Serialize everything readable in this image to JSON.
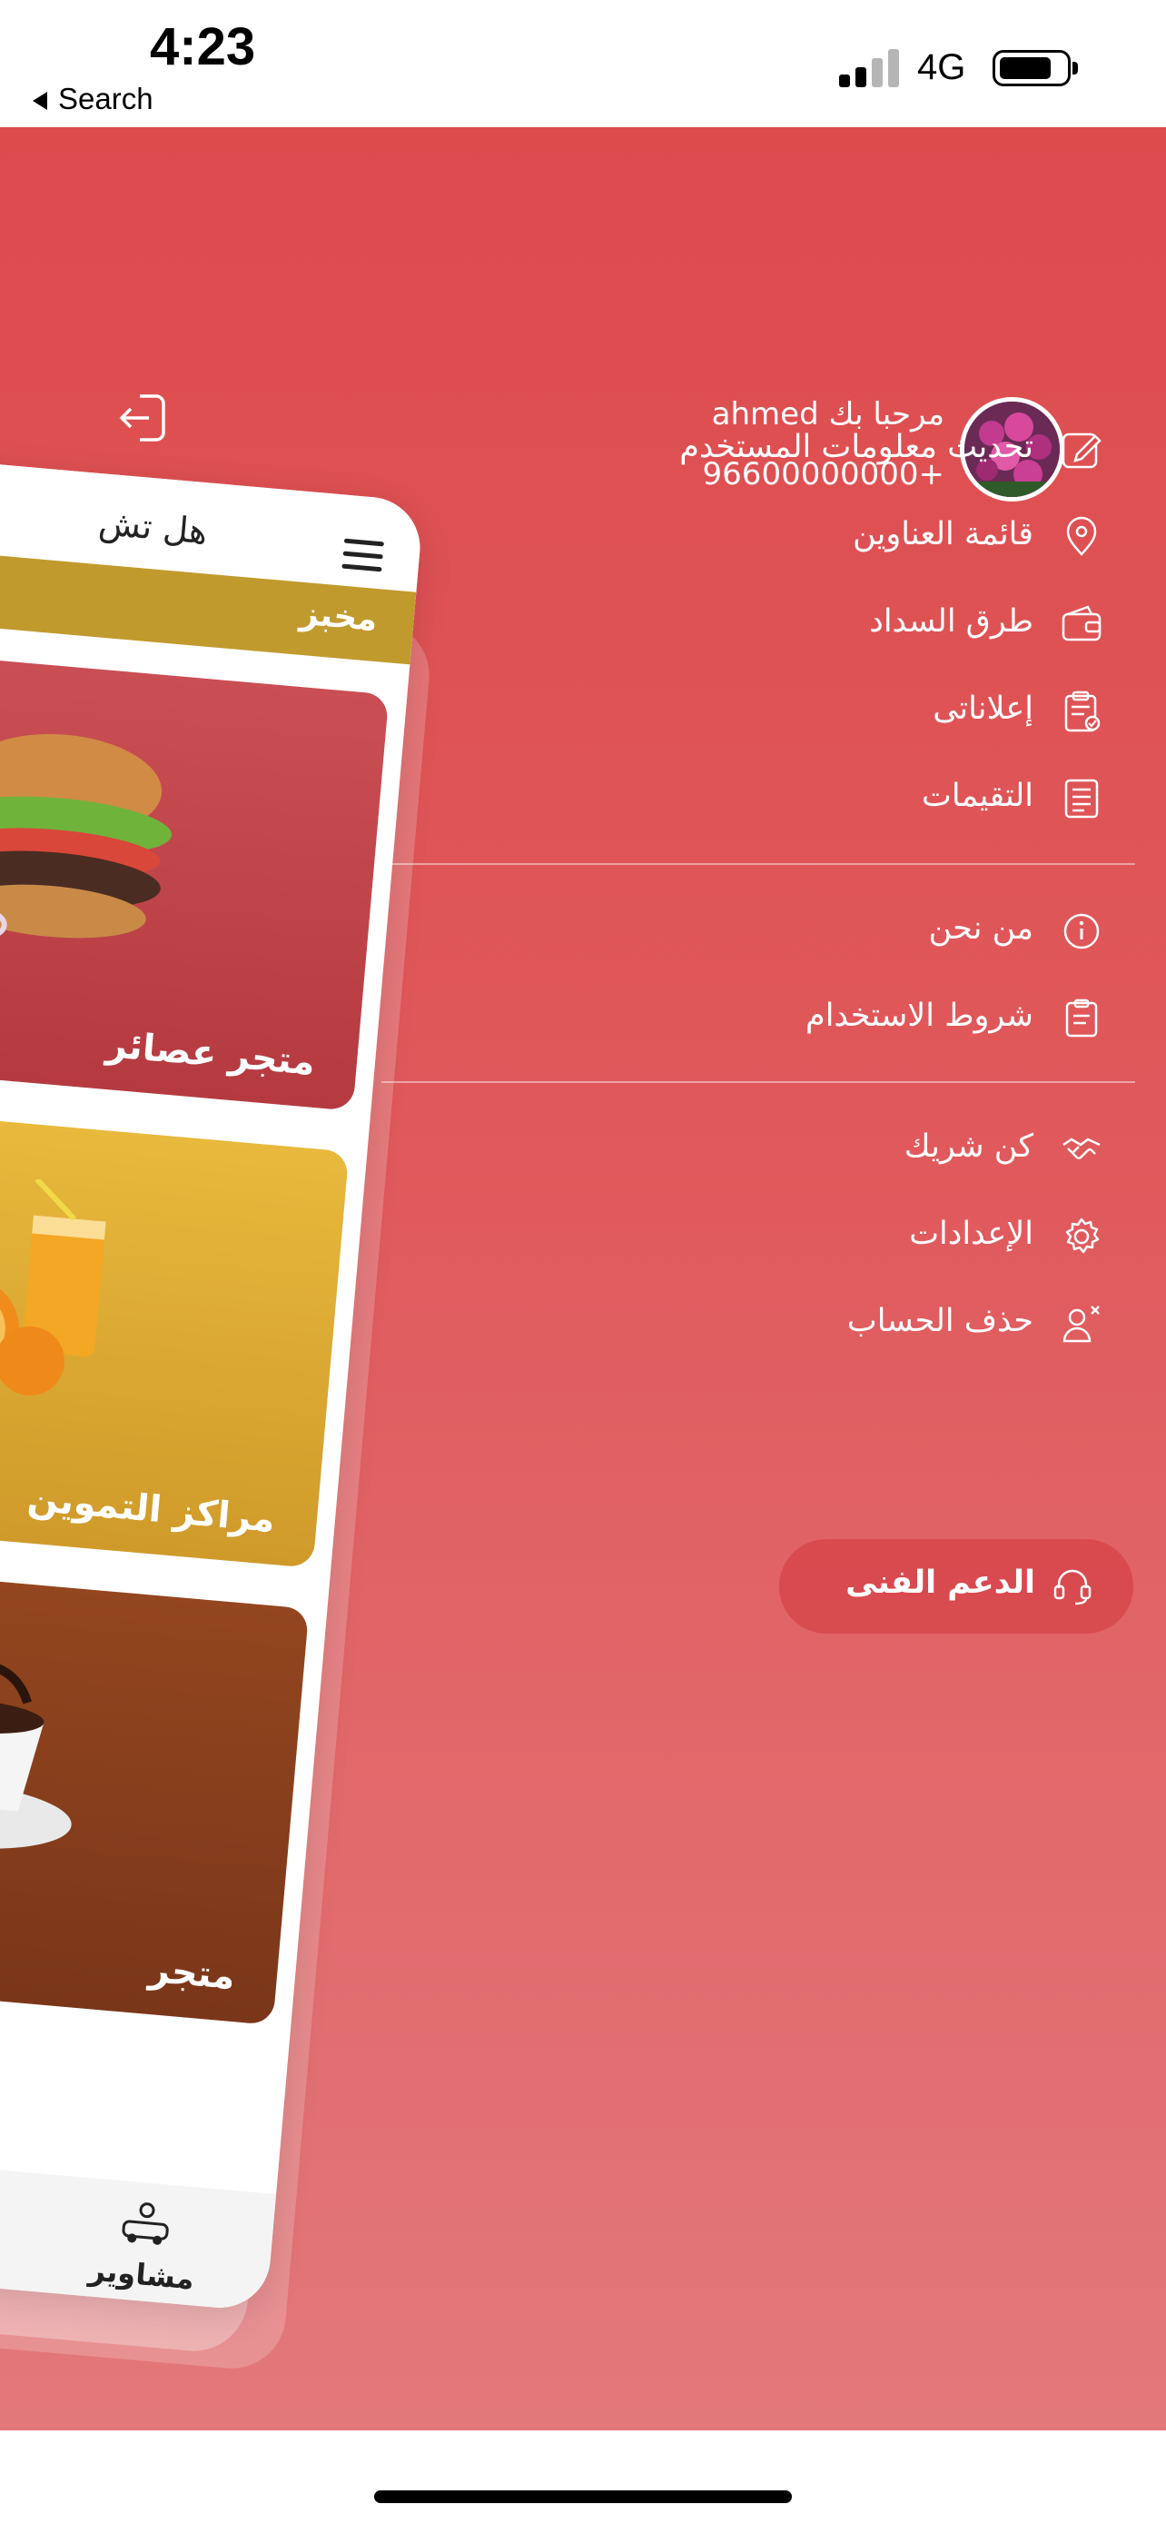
{
  "status_bar": {
    "time": "4:23",
    "back_label": "Search",
    "network": "4G"
  },
  "drawer": {
    "user": {
      "greeting": "مرحبا بك ahmed",
      "phone": "96600000000+"
    },
    "menu_group_1": [
      {
        "label": "تحديث معلومات المستخدم",
        "icon": "edit-icon"
      },
      {
        "label": "قائمة العناوين",
        "icon": "location-pin-icon"
      },
      {
        "label": "طرق السداد",
        "icon": "wallet-icon"
      },
      {
        "label": "إعلاناتى",
        "icon": "clipboard-check-icon"
      },
      {
        "label": "التقيمات",
        "icon": "list-document-icon"
      }
    ],
    "menu_group_2": [
      {
        "label": "من نحن",
        "icon": "info-icon"
      },
      {
        "label": "شروط الاستخدام",
        "icon": "terms-icon"
      }
    ],
    "menu_group_3": [
      {
        "label": "كن شريك",
        "icon": "handshake-icon"
      },
      {
        "label": "الإعدادات",
        "icon": "gear-icon"
      },
      {
        "label": "حذف الحساب",
        "icon": "delete-user-icon"
      }
    ],
    "support_label": "الدعم الفنى"
  },
  "preview": {
    "header_title": "هل تش",
    "strip_label": "مخبز",
    "cards": [
      {
        "label": "متجر عصائر",
        "image": "burger-image",
        "color": "#c4474d"
      },
      {
        "label": "مراكز التموين",
        "image": "orange-juice-image",
        "color": "#e3b538"
      },
      {
        "label": "متجر",
        "image": "coffee-image",
        "color": "#8a4020"
      }
    ],
    "bottom_nav_label": "مشاوير"
  },
  "colors": {
    "drawer_top": "#dd4b4d",
    "drawer_bottom": "#e3787a",
    "strip": "#c19a2e"
  }
}
